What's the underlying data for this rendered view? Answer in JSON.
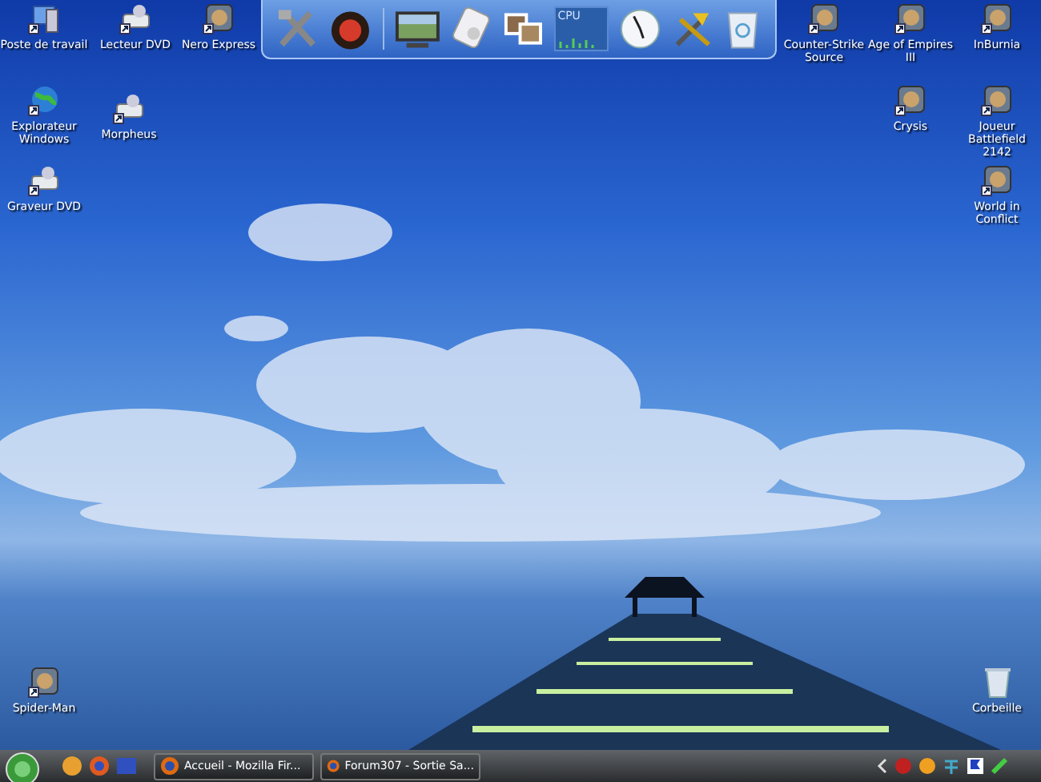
{
  "desktop_icons": [
    {
      "label": "Poste de travail",
      "kind": "computer"
    },
    {
      "label": "Lecteur DVD",
      "kind": "drive"
    },
    {
      "label": "Nero Express",
      "kind": "app"
    },
    {
      "label": "Explorateur Windows",
      "kind": "globe"
    },
    {
      "label": "Morpheus",
      "kind": "drive"
    },
    {
      "label": "Graveur DVD",
      "kind": "drive"
    },
    {
      "label": "Counter-Strike Source",
      "kind": "app"
    },
    {
      "label": "Age of Empires III",
      "kind": "app"
    },
    {
      "label": "InBurnia",
      "kind": "app"
    },
    {
      "label": "Crysis",
      "kind": "app"
    },
    {
      "label": "Joueur Battlefield 2142",
      "kind": "app"
    },
    {
      "label": "World in Conflict",
      "kind": "app"
    },
    {
      "label": "Spider-Man",
      "kind": "app"
    },
    {
      "label": "Corbeille",
      "kind": "trash"
    }
  ],
  "dock": {
    "cpu_label": "CPU"
  },
  "taskbar": {
    "tasks": [
      {
        "label": "Accueil - Mozilla Fir...",
        "selected": false
      },
      {
        "label": "Forum307 - Sortie Sa...",
        "selected": false
      }
    ]
  }
}
